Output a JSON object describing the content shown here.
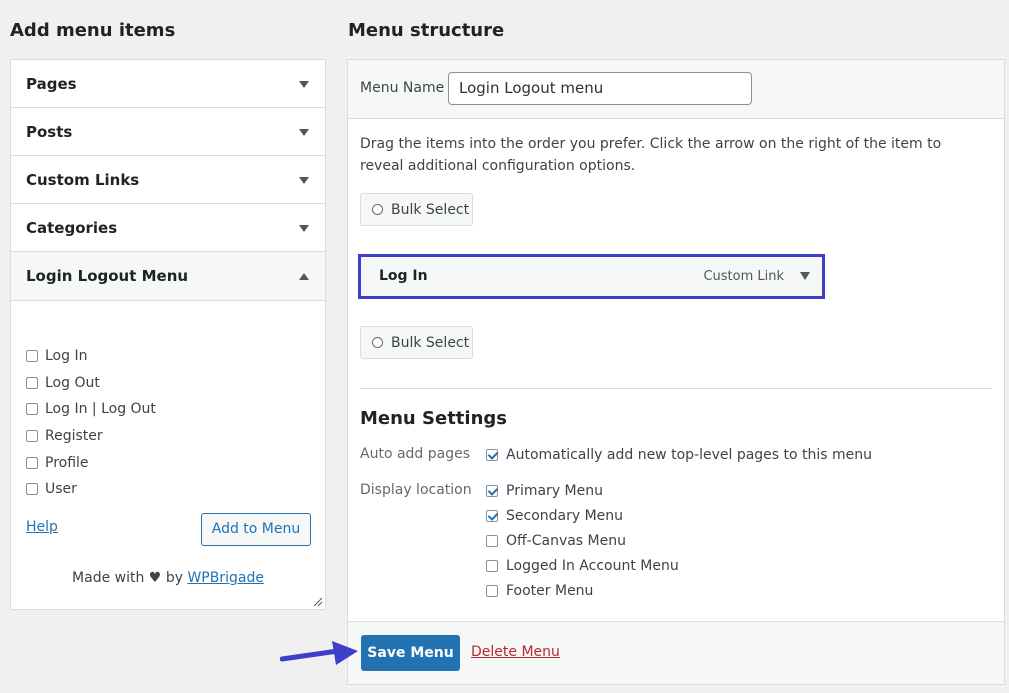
{
  "left": {
    "title": "Add menu items",
    "accordion": [
      {
        "label": "Pages",
        "open": false
      },
      {
        "label": "Posts",
        "open": false
      },
      {
        "label": "Custom Links",
        "open": false
      },
      {
        "label": "Categories",
        "open": false
      },
      {
        "label": "Login Logout Menu",
        "open": true
      }
    ],
    "items": [
      "Log In",
      "Log Out",
      "Log In | Log Out",
      "Register",
      "Profile",
      "User"
    ],
    "help_label": "Help",
    "add_button": "Add to Menu",
    "made_with_prefix": "Made with",
    "heart": "♥",
    "made_with_by": "by",
    "made_with_link": "WPBrigade"
  },
  "right": {
    "title": "Menu structure",
    "menu_name_label": "Menu Name",
    "menu_name_value": "Login Logout menu",
    "instructions": "Drag the items into the order you prefer. Click the arrow on the right of the item to reveal additional configuration options.",
    "bulk_select": "Bulk Select",
    "menu_item": {
      "title": "Log In",
      "type": "Custom Link"
    },
    "settings": {
      "title": "Menu Settings",
      "auto_add_label": "Auto add pages",
      "auto_add_option": "Automatically add new top-level pages to this menu",
      "auto_add_checked": true,
      "display_label": "Display location",
      "locations": [
        {
          "label": "Primary Menu",
          "checked": true
        },
        {
          "label": "Secondary Menu",
          "checked": true
        },
        {
          "label": "Off-Canvas Menu",
          "checked": false
        },
        {
          "label": "Logged In Account Menu",
          "checked": false
        },
        {
          "label": "Footer Menu",
          "checked": false
        }
      ]
    },
    "save_button": "Save Menu",
    "delete_link": "Delete Menu"
  },
  "colors": {
    "primary": "#2271b1",
    "highlight_border": "#3e3fc8",
    "delete": "#b32d2e",
    "arrow": "#3e3fc8"
  }
}
